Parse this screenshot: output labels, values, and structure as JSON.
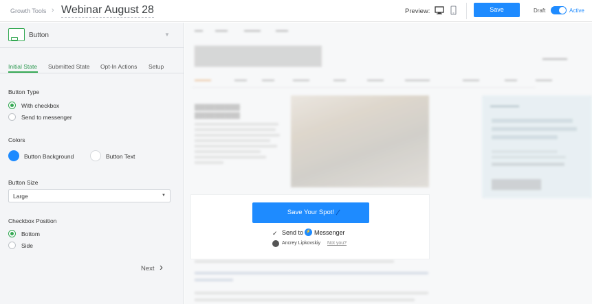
{
  "header": {
    "breadcrumb": "Growth Tools",
    "breadcrumb_sep": "›",
    "title": "Webinar August 28",
    "preview_label": "Preview:",
    "save_label": "Save",
    "draft_label": "Draft",
    "active_label": "Active"
  },
  "panel": {
    "element_name": "Button",
    "tabs": [
      "Initial State",
      "Submitted State",
      "Opt-In Actions",
      "Setup"
    ],
    "active_tab": "Initial State",
    "button_type": {
      "title": "Button Type",
      "options": [
        "With checkbox",
        "Send to messenger"
      ],
      "selected": "With checkbox"
    },
    "colors": {
      "title": "Colors",
      "items": [
        {
          "label": "Button Background",
          "color": "#1e8bff"
        },
        {
          "label": "Button Text",
          "color": "#ffffff"
        }
      ]
    },
    "button_size": {
      "title": "Button Size",
      "value": "Large"
    },
    "checkbox_position": {
      "title": "Checkbox Position",
      "options": [
        "Bottom",
        "Side"
      ],
      "selected": "Bottom"
    },
    "next_label": "Next"
  },
  "preview": {
    "cta_label": "Save Your Spot!",
    "checkbox_label": "Send to",
    "messenger_label": "Messenger",
    "user_name": "Ancrey Lipkovskiy",
    "not_you": "Not you?"
  },
  "colors": {
    "accent": "#1e8bff",
    "success": "#34a853"
  },
  "icons": [
    "desktop-icon",
    "mobile-icon",
    "chevron-down-icon",
    "chevron-right-icon",
    "messenger-icon",
    "check-icon"
  ]
}
